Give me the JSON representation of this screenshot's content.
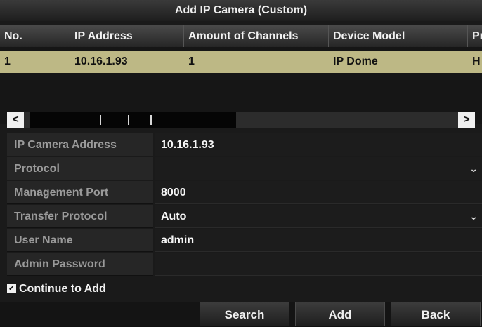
{
  "dialog": {
    "title": "Add IP Camera (Custom)"
  },
  "table": {
    "headers": [
      "No.",
      "IP Address",
      "Amount of Channels",
      "Device Model",
      "Pr"
    ],
    "rows": [
      {
        "no": "1",
        "ip": "10.16.1.93",
        "channels": "1",
        "model": "IP Dome",
        "protocol": "H"
      }
    ],
    "scroll": {
      "left_icon": "chevron-left-icon",
      "right_icon": "chevron-right-icon",
      "left_glyph": "<",
      "right_glyph": ">"
    }
  },
  "form": {
    "fields": [
      {
        "label": "IP Camera Address",
        "value": "10.16.1.93",
        "dropdown": false
      },
      {
        "label": "Protocol",
        "value": "",
        "dropdown": true
      },
      {
        "label": "Management Port",
        "value": "8000",
        "dropdown": false
      },
      {
        "label": "Transfer Protocol",
        "value": "Auto",
        "dropdown": true
      },
      {
        "label": "User Name",
        "value": "admin",
        "dropdown": false
      },
      {
        "label": "Admin Password",
        "value": "",
        "dropdown": false
      }
    ]
  },
  "continue_to_add": {
    "label": "Continue to Add",
    "checked": true
  },
  "buttons": {
    "search": "Search",
    "add": "Add",
    "back": "Back"
  },
  "colors": {
    "selected_row": "#bdb885",
    "background": "#1a1a1a"
  }
}
